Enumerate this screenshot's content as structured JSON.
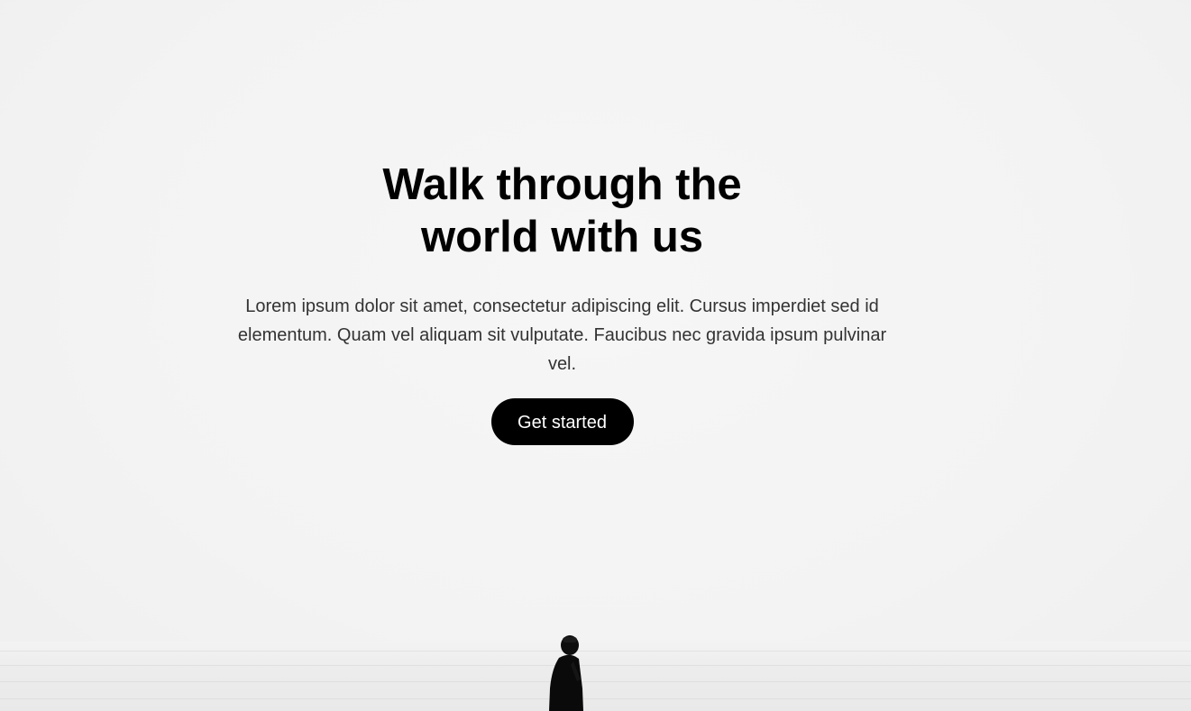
{
  "hero": {
    "headline": "Walk through the world with us",
    "description": "Lorem ipsum dolor sit amet, consectetur adipiscing elit. Cursus imperdiet sed id elementum. Quam vel aliquam sit vulputate. Faucibus nec gravida ipsum pulvinar vel.",
    "cta_label": "Get started",
    "colors": {
      "background": "#f4f4f4",
      "headline": "#000000",
      "description": "#333333",
      "button_bg": "#000000",
      "button_text": "#ffffff"
    }
  }
}
